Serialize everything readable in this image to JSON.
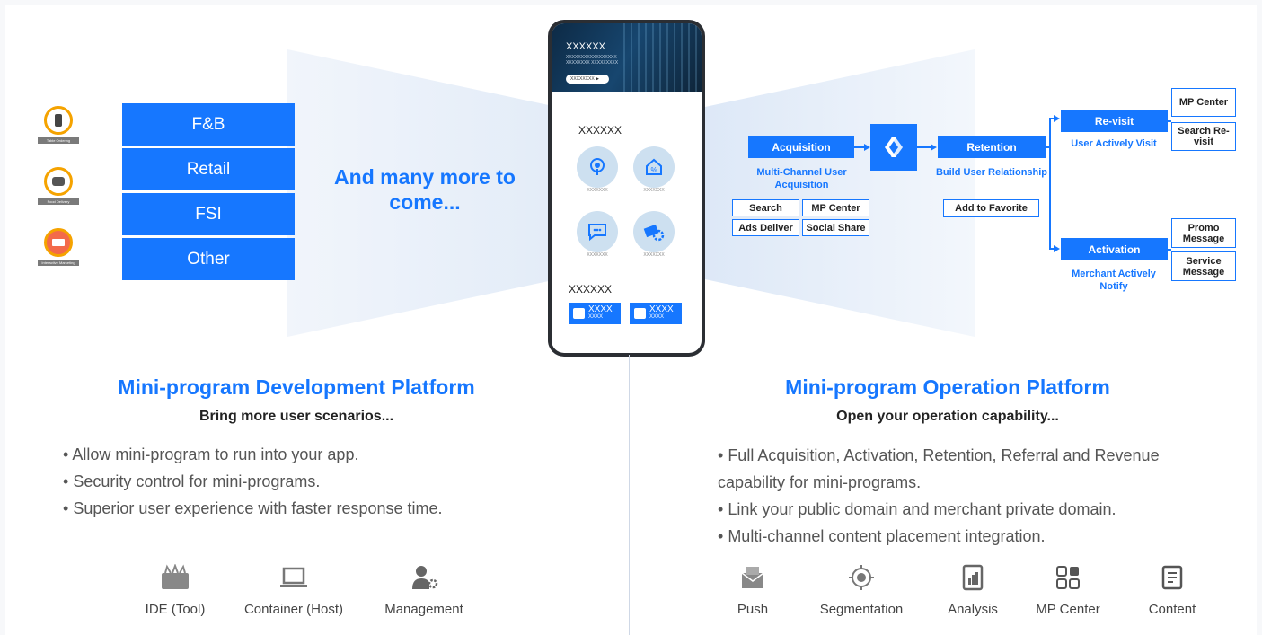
{
  "categories": {
    "icons": [
      {
        "name": "table-ordering-icon",
        "caption": "Table Ordering"
      },
      {
        "name": "food-delivery-icon",
        "caption": "Food Delivery"
      },
      {
        "name": "interactive-marketing-icon",
        "caption": "Interactive Marketing"
      }
    ],
    "items": [
      "F&B",
      "Retail",
      "FSI",
      "Other"
    ],
    "more_text": "And many more to come..."
  },
  "phone": {
    "banner_title": "XXXXXX",
    "banner_sub": "XXXXXXXXXXXXXXXXX XXXXXXXX XXXXXXXXX",
    "banner_button": "XXXXXXXX ▶",
    "section1_title": "XXXXXX",
    "apps": [
      {
        "icon": "podcast-icon",
        "label": "XXXXXXX"
      },
      {
        "icon": "discount-icon",
        "label": "XXXXXXX"
      },
      {
        "icon": "chat-icon",
        "label": "XXXXXXX"
      },
      {
        "icon": "money-gear-icon",
        "label": "XXXXXXX"
      }
    ],
    "section2_title": "XXXXXX",
    "buttons": [
      {
        "icon": "spy-icon",
        "label": "XXXX",
        "sub": "XXXX"
      },
      {
        "icon": "gamepad-icon",
        "label": "XXXX",
        "sub": "XXXX"
      }
    ]
  },
  "flow": {
    "acquisition": {
      "label": "Acquisition",
      "desc": "Multi-Channel User Acquisition",
      "options": [
        "Search",
        "MP Center",
        "Ads Deliver",
        "Social Share"
      ]
    },
    "retention": {
      "label": "Retention",
      "desc": "Build User Relationship",
      "option": "Add to Favorite"
    },
    "revisit": {
      "label": "Re-visit",
      "desc": "User Actively Visit",
      "options": [
        "MP Center",
        "Search Re-visit"
      ]
    },
    "activation": {
      "label": "Activation",
      "desc": "Merchant Actively Notify",
      "options": [
        "Promo Message",
        "Service Message"
      ]
    }
  },
  "dev_platform": {
    "title": "Mini-program Development Platform",
    "subtitle": "Bring more user scenarios...",
    "bullets": [
      "Allow mini-program to run into your app.",
      "Security control for mini-programs.",
      "Superior user experience with faster response time."
    ],
    "tools": [
      {
        "icon": "toolbox-icon",
        "label": "IDE (Tool)"
      },
      {
        "icon": "laptop-icon",
        "label": "Container (Host)"
      },
      {
        "icon": "user-gear-icon",
        "label": "Management"
      }
    ]
  },
  "ops_platform": {
    "title": "Mini-program Operation Platform",
    "subtitle": "Open your operation capability...",
    "bullets": [
      "Full Acquisition, Activation, Retention, Referral and Revenue capability for mini-programs.",
      "Link your public domain and merchant private domain.",
      "Multi-channel content placement integration."
    ],
    "tools": [
      {
        "icon": "envelope-icon",
        "label": "Push"
      },
      {
        "icon": "target-icon",
        "label": "Segmentation"
      },
      {
        "icon": "chart-icon",
        "label": "Analysis"
      },
      {
        "icon": "grid-icon",
        "label": "MP Center"
      },
      {
        "icon": "document-icon",
        "label": "Content"
      }
    ]
  },
  "colors": {
    "accent": "#1677ff",
    "icon_ring": "#f5a300"
  }
}
